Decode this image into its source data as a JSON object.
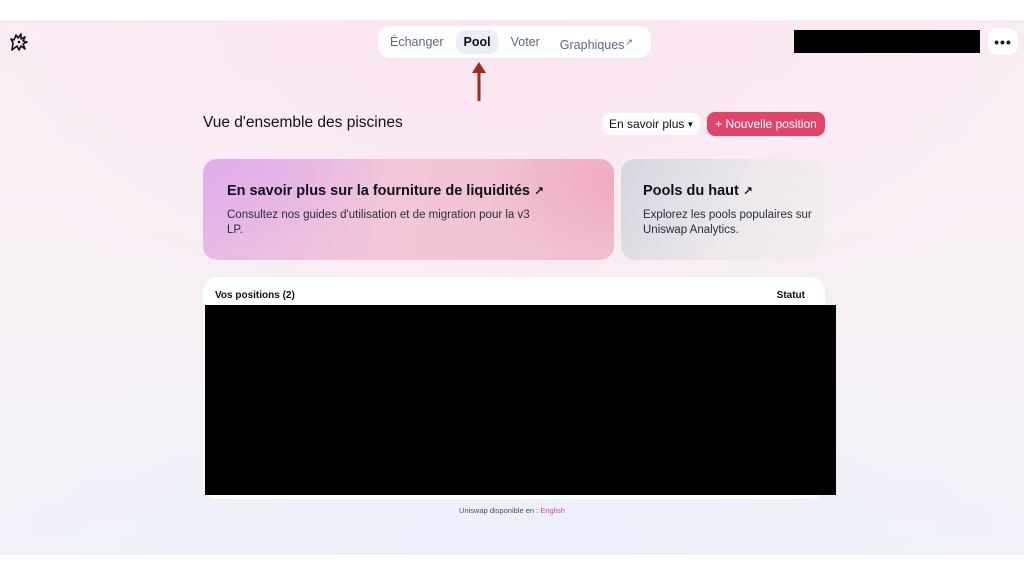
{
  "nav": {
    "items": [
      {
        "label": "Échanger"
      },
      {
        "label": "Pool",
        "active": true
      },
      {
        "label": "Voter"
      },
      {
        "label": "Graphiques",
        "external_icon": "↗"
      }
    ]
  },
  "header": {
    "logo_icon": "unicorn-logo-icon",
    "more_label": "•••"
  },
  "page": {
    "title": "Vue d'ensemble des piscines",
    "learn_more_label": "En savoir plus",
    "learn_more_chevron": "⌄",
    "new_position_label": "+ Nouvelle position"
  },
  "cards": {
    "liquidity": {
      "title": "En savoir plus sur la fourniture de liquidités",
      "arrow": "↗",
      "description": "Consultez nos guides d'utilisation et de migration pour la v3 LP."
    },
    "top_pools": {
      "title": "Pools du haut",
      "arrow": "↗",
      "description": "Explorez les pools populaires sur Uniswap Analytics."
    }
  },
  "positions": {
    "label": "Vos positions (2)",
    "status_label": "Statut"
  },
  "footer": {
    "text": "Uniswap disponible en : ",
    "language": "English"
  },
  "colors": {
    "accent": "#e0466c",
    "annotation_arrow": "#a52a1a",
    "link": "#e04680"
  }
}
